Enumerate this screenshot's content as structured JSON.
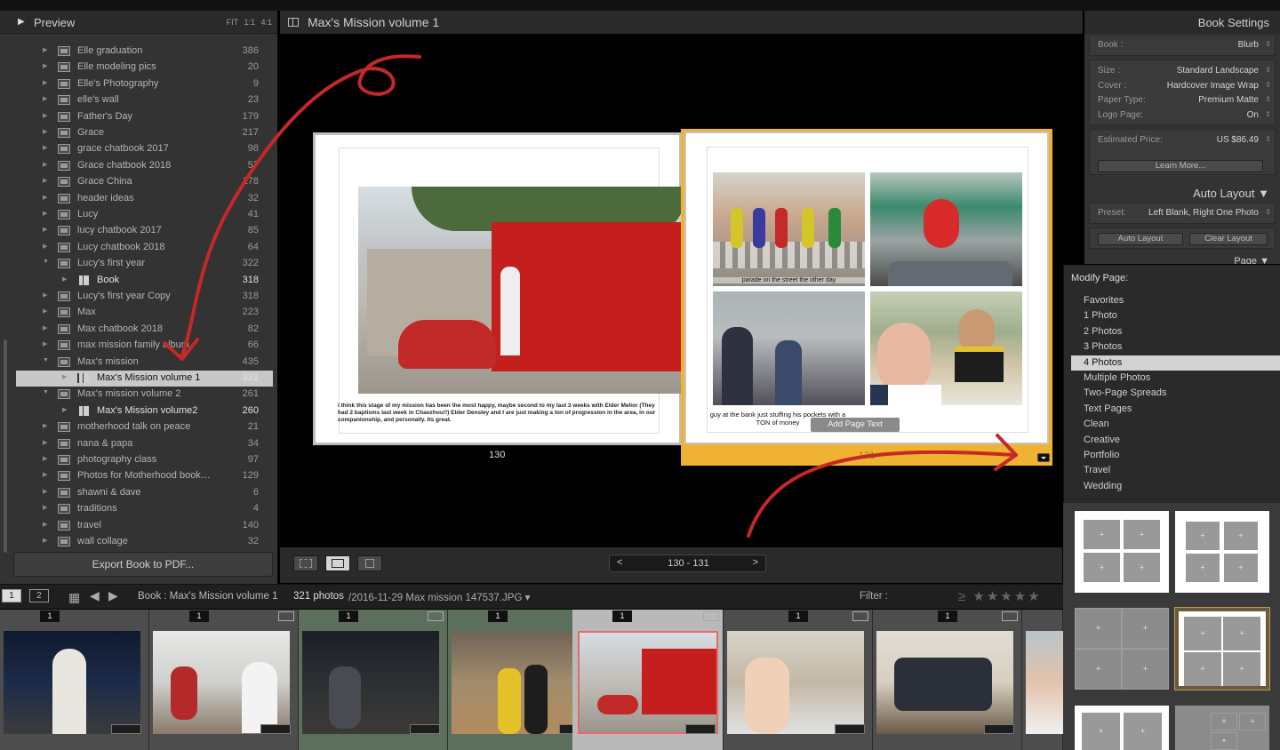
{
  "preview": {
    "title": "Preview",
    "zooms": "FIT 1:1 4:1"
  },
  "collections": [
    {
      "name": "Elle graduation",
      "count": "386",
      "type": "col"
    },
    {
      "name": "Elle modeling pics",
      "count": "20",
      "type": "col"
    },
    {
      "name": "Elle's Photography",
      "count": "9",
      "type": "col"
    },
    {
      "name": "elle's wall",
      "count": "23",
      "type": "col"
    },
    {
      "name": "Father's Day",
      "count": "179",
      "type": "col"
    },
    {
      "name": "Grace",
      "count": "217",
      "type": "col"
    },
    {
      "name": "grace chatbook 2017",
      "count": "98",
      "type": "col"
    },
    {
      "name": "Grace chatbook 2018",
      "count": "57",
      "type": "col"
    },
    {
      "name": "Grace China",
      "count": "178",
      "type": "col"
    },
    {
      "name": "header ideas",
      "count": "32",
      "type": "col"
    },
    {
      "name": "Lucy",
      "count": "41",
      "type": "col"
    },
    {
      "name": "lucy chatbook 2017",
      "count": "85",
      "type": "col"
    },
    {
      "name": "Lucy chatbook 2018",
      "count": "64",
      "type": "col"
    },
    {
      "name": "Lucy's first year",
      "count": "322",
      "type": "col",
      "expanded": true
    },
    {
      "name": "Book",
      "count": "318",
      "type": "book",
      "indent": true
    },
    {
      "name": "Lucy's first year Copy",
      "count": "318",
      "type": "col"
    },
    {
      "name": "Max",
      "count": "223",
      "type": "col"
    },
    {
      "name": "Max chatbook 2018",
      "count": "82",
      "type": "col"
    },
    {
      "name": "max mission family album",
      "count": "66",
      "type": "col"
    },
    {
      "name": "Max's mission",
      "count": "435",
      "type": "col",
      "expanded": true
    },
    {
      "name": "Max's Mission volume 1",
      "count": "321",
      "type": "book",
      "indent": true,
      "selected": true
    },
    {
      "name": "Max's mission volume 2",
      "count": "261",
      "type": "col",
      "expanded": true
    },
    {
      "name": "Max's Mission volume2",
      "count": "260",
      "type": "book",
      "indent": true
    },
    {
      "name": "motherhood talk on peace",
      "count": "21",
      "type": "col"
    },
    {
      "name": "nana & papa",
      "count": "34",
      "type": "col"
    },
    {
      "name": "photography class",
      "count": "97",
      "type": "col"
    },
    {
      "name": "Photos for Motherhood book…",
      "count": "129",
      "type": "col"
    },
    {
      "name": "shawni & dave",
      "count": "6",
      "type": "col"
    },
    {
      "name": "traditions",
      "count": "4",
      "type": "col"
    },
    {
      "name": "travel",
      "count": "140",
      "type": "col"
    },
    {
      "name": "wall collage",
      "count": "32",
      "type": "col"
    }
  ],
  "export_label": "Export Book to PDF...",
  "book_title": "Max's Mission volume 1",
  "left_page": {
    "caption": "i think this stage of my mission has been the most happy, maybe second to my last 3 weeks with Elder Melior (They had 2 baptisms last week in Chaozhou!!) Elder Densley and I are just making a ton of progression in the area, in our companionship, and personally. Its great.",
    "number": "130"
  },
  "right_page": {
    "photo1_caption": "parade on the street the other day",
    "bottom_caption": "guy at the bank just stuffing his pockets with a TON of money",
    "add_text_label": "Add Page Text",
    "number": "131"
  },
  "pager": {
    "prev": "<",
    "range": "130  -  131",
    "next": ">"
  },
  "book_settings": {
    "header": "Book Settings",
    "book_label": "Book :",
    "book_value": "Blurb",
    "size_label": "Size :",
    "size_value": "Standard Landscape",
    "cover_label": "Cover :",
    "cover_value": "Hardcover Image Wrap",
    "paper_label": "Paper Type:",
    "paper_value": "Premium Matte",
    "logo_label": "Logo Page:",
    "logo_value": "On",
    "price_label": "Estimated Price:",
    "price_value": "US $86.49",
    "learn_more": "Learn More..."
  },
  "auto_layout": {
    "header": "Auto Layout",
    "preset_label": "Preset:",
    "preset_value": "Left Blank, Right One Photo",
    "auto_btn": "Auto Layout",
    "clear_btn": "Clear Layout"
  },
  "page_header": "Page",
  "modify_page": {
    "title": "Modify Page:",
    "items": [
      "Favorites",
      "1 Photo",
      "2 Photos",
      "3 Photos",
      "4 Photos",
      "Multiple Photos",
      "Two-Page Spreads",
      "Text Pages",
      "Clean",
      "Creative",
      "Portfolio",
      "Travel",
      "Wedding"
    ],
    "selected": "4 Photos"
  },
  "filmbar": {
    "mon1": "1",
    "mon2": "2",
    "source": "Book : Max's Mission volume 1",
    "count": "321 photos",
    "path": "/2016-11-29 Max mission 147537.JPG ▾",
    "filter": "Filter :",
    "stars": "≥ ★★★★★"
  },
  "filmstrip": [
    {
      "num": "1"
    },
    {
      "num": "1"
    },
    {
      "num": "1"
    },
    {
      "num": "1"
    },
    {
      "num": "1"
    },
    {
      "num": "1"
    },
    {
      "num": "1"
    }
  ],
  "colors": {
    "accent": "#efb233",
    "annotation": "#c62828",
    "selection": "#c8c8c8"
  }
}
